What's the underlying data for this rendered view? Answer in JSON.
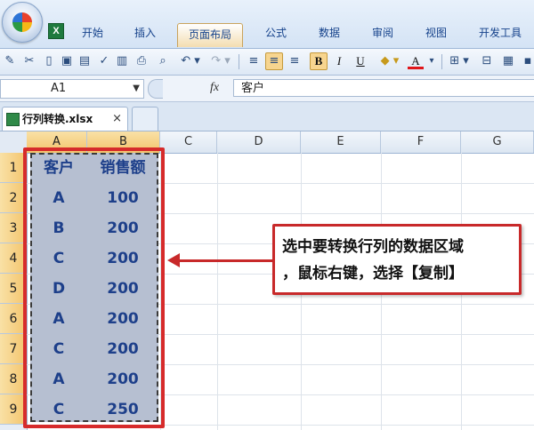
{
  "ribbon": {
    "tabs": [
      "开始",
      "插入",
      "页面布局",
      "公式",
      "数据",
      "审阅",
      "视图",
      "开发工具"
    ],
    "active_tab": "页面布局"
  },
  "toolbar": {
    "icons": [
      "format-painter-icon",
      "cut-icon",
      "new-icon",
      "save-icon",
      "print-preview-icon",
      "spell-check-icon",
      "paste-icon",
      "print-icon",
      "undo-icon",
      "redo-icon",
      "align-left-icon",
      "align-center-icon",
      "align-right-icon",
      "bold-icon",
      "italic-icon",
      "underline-icon",
      "fill-color-icon",
      "font-color-icon",
      "borders-icon",
      "merge-icon",
      "format-cells-icon"
    ],
    "bold": "B",
    "italic": "I",
    "underline": "U",
    "font_color": "A"
  },
  "formula_bar": {
    "name_box": "A1",
    "fx": "fx",
    "content": "客户"
  },
  "document": {
    "tab_name": "行列转换.xlsx",
    "close": "×"
  },
  "sheet": {
    "columns": [
      "A",
      "B",
      "C",
      "D",
      "E",
      "F",
      "G"
    ],
    "rows": [
      "1",
      "2",
      "3",
      "4",
      "5",
      "6",
      "7",
      "8",
      "9"
    ],
    "data": [
      [
        "客户",
        "销售额"
      ],
      [
        "A",
        "100"
      ],
      [
        "B",
        "200"
      ],
      [
        "C",
        "200"
      ],
      [
        "D",
        "200"
      ],
      [
        "A",
        "200"
      ],
      [
        "C",
        "200"
      ],
      [
        "A",
        "200"
      ],
      [
        "C",
        "250"
      ]
    ]
  },
  "annotation": {
    "line1": "选中要转换行列的数据区域",
    "line2": "，鼠标右键，选择【复制】"
  },
  "colors": {
    "highlight": "#d62b2b",
    "cell_text": "#1d3f8a",
    "selection_fill": "#b6bfd1"
  }
}
